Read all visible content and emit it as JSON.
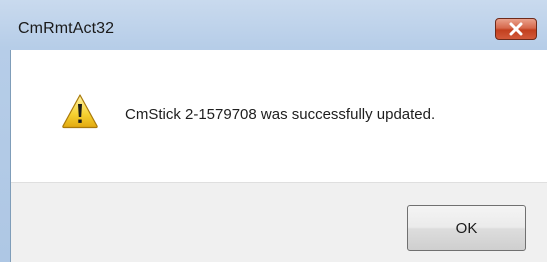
{
  "window": {
    "title": "CmRmtAct32",
    "close_icon": "close-icon"
  },
  "dialog": {
    "icon": "warning-icon",
    "message": "CmStick 2-1579708 was successfully updated.",
    "ok_label": "OK"
  },
  "colors": {
    "title_bar": "#b6cde8",
    "close_button": "#d2593a",
    "warning_yellow": "#f7d23a",
    "button_area": "#f0f0f0"
  }
}
